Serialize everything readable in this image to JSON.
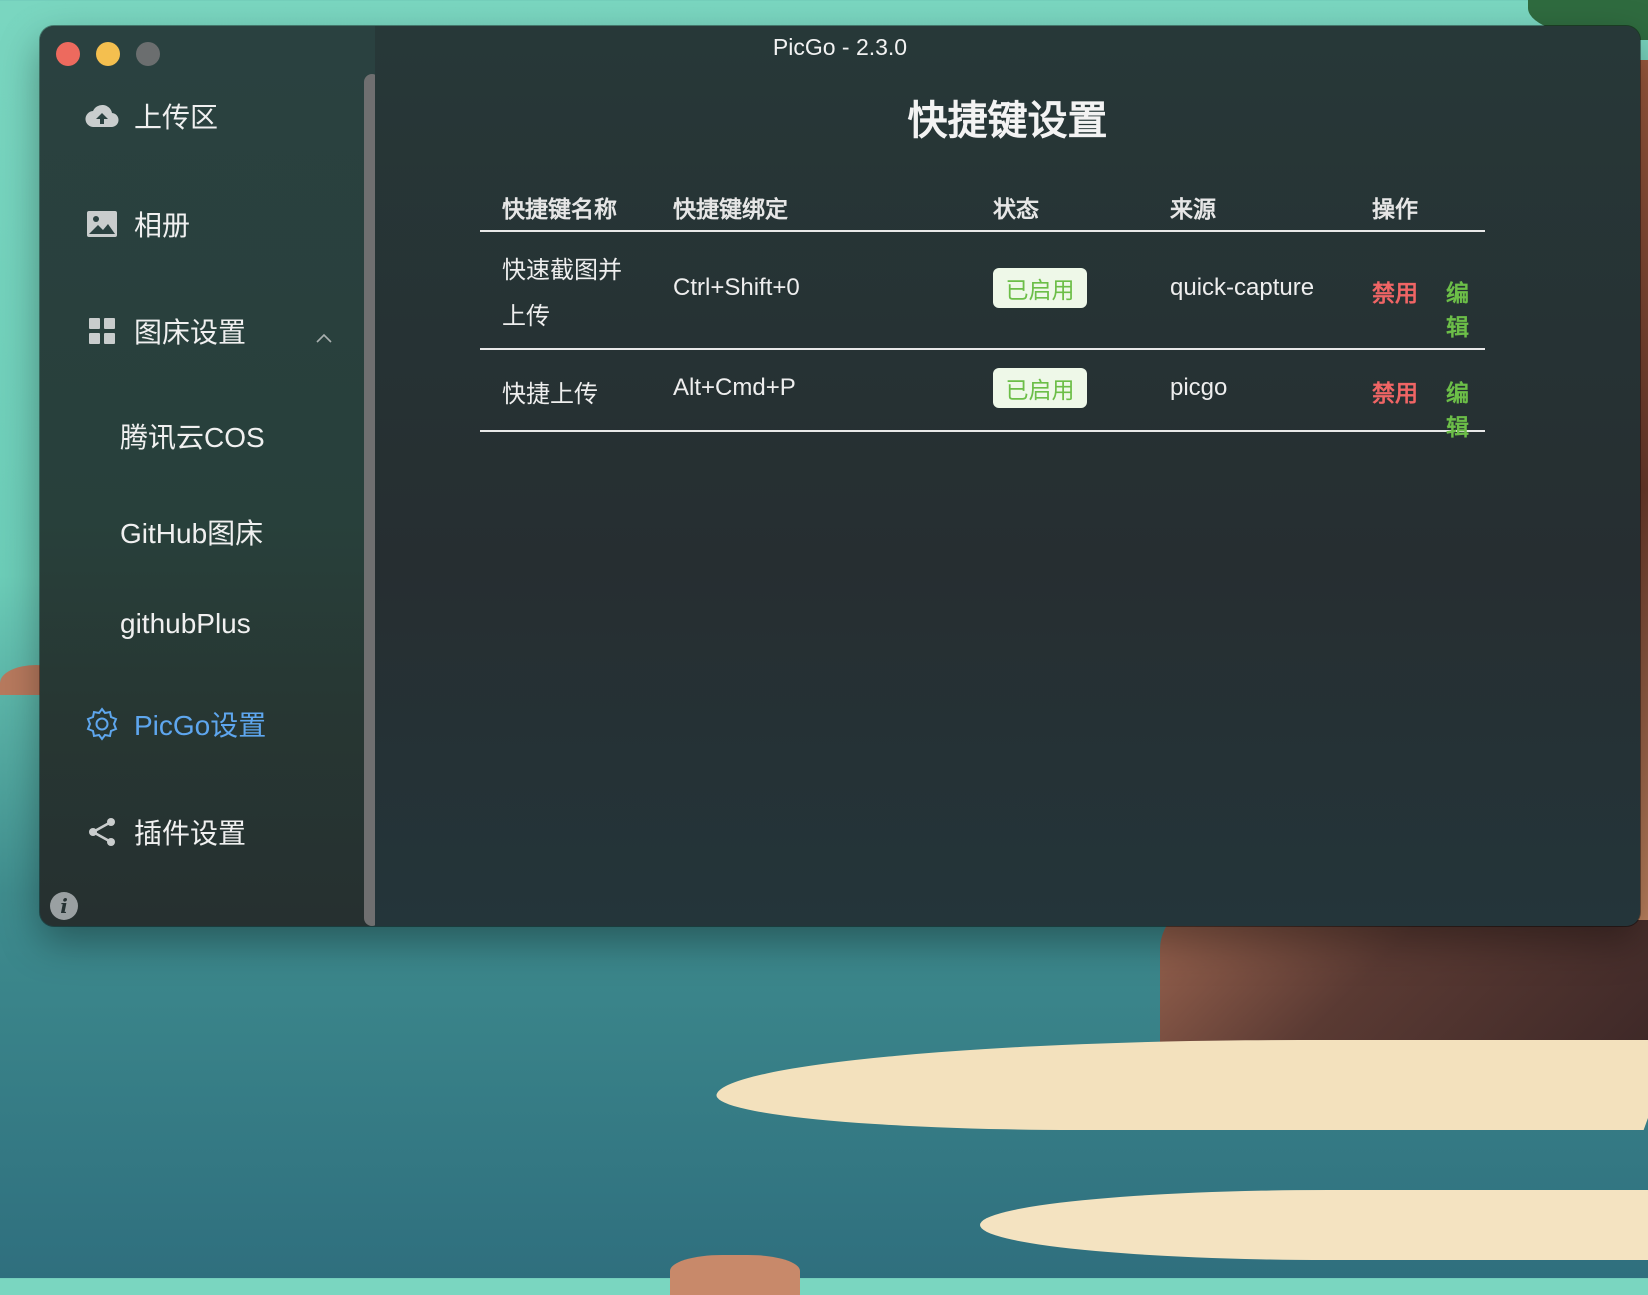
{
  "window": {
    "title": "PicGo - 2.3.0"
  },
  "sidebar": {
    "items": [
      {
        "label": "上传区",
        "icon": "cloud-upload-icon"
      },
      {
        "label": "相册",
        "icon": "picture-icon"
      },
      {
        "label": "图床设置",
        "icon": "grid-icon",
        "expanded": true
      },
      {
        "label": "PicGo设置",
        "icon": "gear-icon",
        "active": true
      },
      {
        "label": "插件设置",
        "icon": "share-icon"
      }
    ],
    "sub_items": [
      {
        "label": "腾讯云COS"
      },
      {
        "label": "GitHub图床"
      },
      {
        "label": "githubPlus"
      }
    ],
    "info_label": "i"
  },
  "main": {
    "page_title": "快捷键设置",
    "table": {
      "headers": [
        "快捷键名称",
        "快捷键绑定",
        "状态",
        "来源",
        "操作"
      ],
      "rows": [
        {
          "name_line1": "快速截图并",
          "name_line2": "上传",
          "binding": "Ctrl+Shift+0",
          "status": "已启用",
          "source": "quick-capture",
          "disable": "禁用",
          "edit": "编辑"
        },
        {
          "name_line1": "快捷上传",
          "binding": "Alt+Cmd+P",
          "status": "已启用",
          "source": "picgo",
          "disable": "禁用",
          "edit": "编辑"
        }
      ]
    }
  },
  "colors": {
    "accent_blue": "#5ea6ee",
    "enabled_green": "#6cbe48",
    "danger_red": "#f06565"
  }
}
